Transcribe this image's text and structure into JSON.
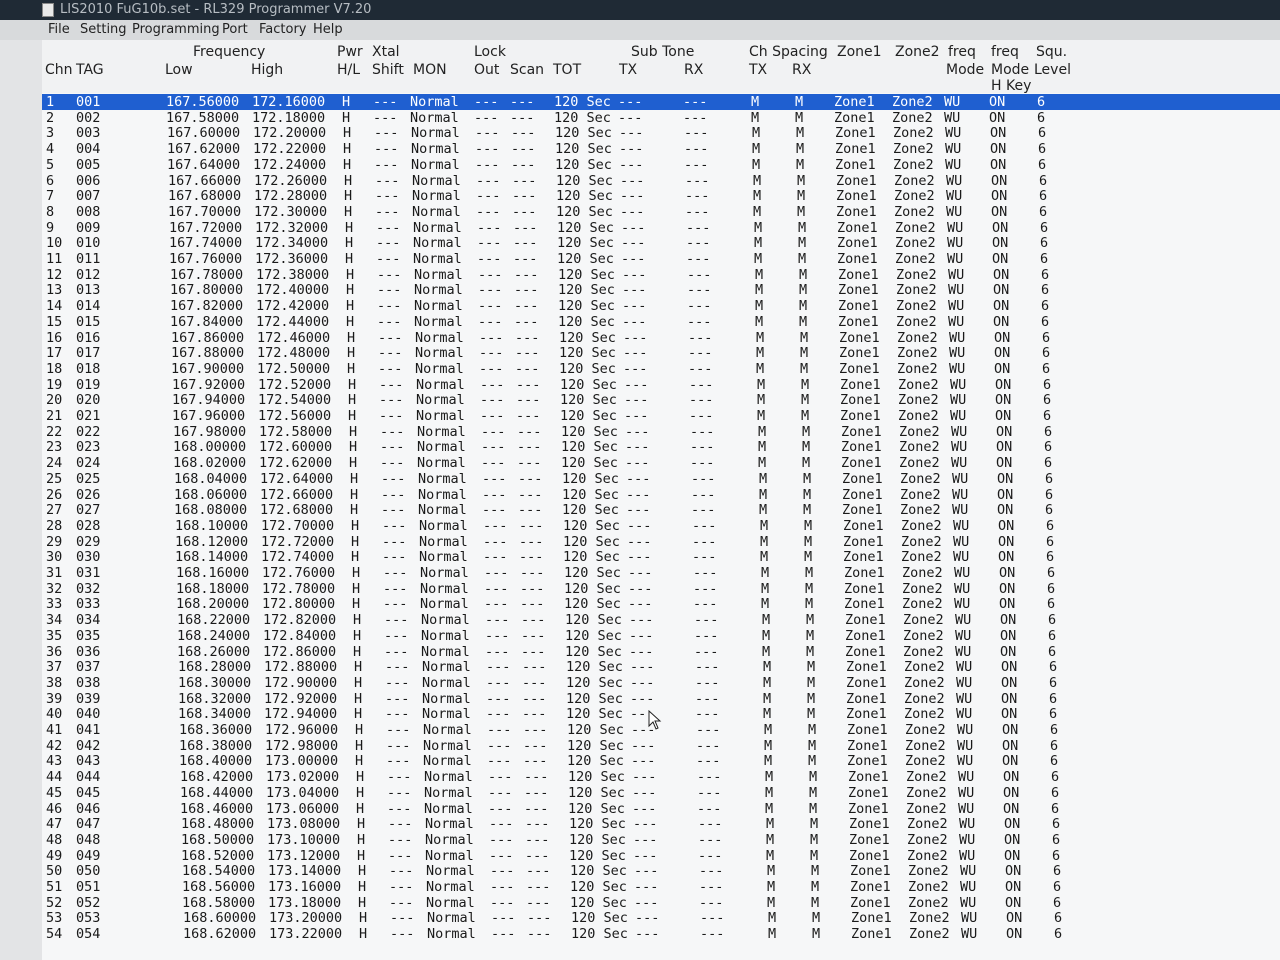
{
  "window": {
    "title": "LIS2010 FuG10b.set - RL329 Programmer V7.20"
  },
  "menu": {
    "items": [
      "File",
      "Setting",
      "Programming",
      "Port",
      "Factory",
      "Help"
    ]
  },
  "columns": {
    "chn": "Chn",
    "tag": "TAG",
    "frequency": "Frequency",
    "low": "Low",
    "high": "High",
    "pwr": "Pwr",
    "hl": "H/L",
    "xtal": "Xtal",
    "shift": "Shift",
    "mon": "MON",
    "lock": "Lock",
    "out": "Out",
    "scan": "Scan",
    "tot": "TOT",
    "subtone": "Sub Tone",
    "subtone_tx": "TX",
    "subtone_rx": "RX",
    "chspacing": "Ch Spacing",
    "chspacing_tx": "TX",
    "chspacing_rx": "RX",
    "zone1": "Zone1",
    "zone2": "Zone2",
    "freqmode": "freq",
    "freqmode2": "Mode",
    "freqhkey": "freq",
    "freqhkey2": "Mode",
    "freqhkey3": "H Key",
    "squ": "Squ.",
    "squ2": "Level"
  },
  "defaults": {
    "pwr": "H",
    "xtal_shift": "---",
    "mon": "Normal",
    "lock_out": "---",
    "scan": "---",
    "tot": "120 Sec",
    "sub_tx": "---",
    "sub_rx": "---",
    "ch_tx": "M",
    "ch_rx": "M",
    "zone1": "Zone1",
    "zone2": "Zone2",
    "freq_mode": "WU",
    "h_key": "ON",
    "squ_level": "6"
  },
  "rows": [
    {
      "chn": "1",
      "tag": "001",
      "low": "167.56000",
      "high": "172.16000"
    },
    {
      "chn": "2",
      "tag": "002",
      "low": "167.58000",
      "high": "172.18000"
    },
    {
      "chn": "3",
      "tag": "003",
      "low": "167.60000",
      "high": "172.20000"
    },
    {
      "chn": "4",
      "tag": "004",
      "low": "167.62000",
      "high": "172.22000"
    },
    {
      "chn": "5",
      "tag": "005",
      "low": "167.64000",
      "high": "172.24000"
    },
    {
      "chn": "6",
      "tag": "006",
      "low": "167.66000",
      "high": "172.26000"
    },
    {
      "chn": "7",
      "tag": "007",
      "low": "167.68000",
      "high": "172.28000"
    },
    {
      "chn": "8",
      "tag": "008",
      "low": "167.70000",
      "high": "172.30000"
    },
    {
      "chn": "9",
      "tag": "009",
      "low": "167.72000",
      "high": "172.32000"
    },
    {
      "chn": "10",
      "tag": "010",
      "low": "167.74000",
      "high": "172.34000"
    },
    {
      "chn": "11",
      "tag": "011",
      "low": "167.76000",
      "high": "172.36000"
    },
    {
      "chn": "12",
      "tag": "012",
      "low": "167.78000",
      "high": "172.38000"
    },
    {
      "chn": "13",
      "tag": "013",
      "low": "167.80000",
      "high": "172.40000"
    },
    {
      "chn": "14",
      "tag": "014",
      "low": "167.82000",
      "high": "172.42000"
    },
    {
      "chn": "15",
      "tag": "015",
      "low": "167.84000",
      "high": "172.44000"
    },
    {
      "chn": "16",
      "tag": "016",
      "low": "167.86000",
      "high": "172.46000"
    },
    {
      "chn": "17",
      "tag": "017",
      "low": "167.88000",
      "high": "172.48000"
    },
    {
      "chn": "18",
      "tag": "018",
      "low": "167.90000",
      "high": "172.50000"
    },
    {
      "chn": "19",
      "tag": "019",
      "low": "167.92000",
      "high": "172.52000"
    },
    {
      "chn": "20",
      "tag": "020",
      "low": "167.94000",
      "high": "172.54000"
    },
    {
      "chn": "21",
      "tag": "021",
      "low": "167.96000",
      "high": "172.56000"
    },
    {
      "chn": "22",
      "tag": "022",
      "low": "167.98000",
      "high": "172.58000"
    },
    {
      "chn": "23",
      "tag": "023",
      "low": "168.00000",
      "high": "172.60000"
    },
    {
      "chn": "24",
      "tag": "024",
      "low": "168.02000",
      "high": "172.62000"
    },
    {
      "chn": "25",
      "tag": "025",
      "low": "168.04000",
      "high": "172.64000"
    },
    {
      "chn": "26",
      "tag": "026",
      "low": "168.06000",
      "high": "172.66000"
    },
    {
      "chn": "27",
      "tag": "027",
      "low": "168.08000",
      "high": "172.68000"
    },
    {
      "chn": "28",
      "tag": "028",
      "low": "168.10000",
      "high": "172.70000"
    },
    {
      "chn": "29",
      "tag": "029",
      "low": "168.12000",
      "high": "172.72000"
    },
    {
      "chn": "30",
      "tag": "030",
      "low": "168.14000",
      "high": "172.74000"
    },
    {
      "chn": "31",
      "tag": "031",
      "low": "168.16000",
      "high": "172.76000"
    },
    {
      "chn": "32",
      "tag": "032",
      "low": "168.18000",
      "high": "172.78000"
    },
    {
      "chn": "33",
      "tag": "033",
      "low": "168.20000",
      "high": "172.80000"
    },
    {
      "chn": "34",
      "tag": "034",
      "low": "168.22000",
      "high": "172.82000"
    },
    {
      "chn": "35",
      "tag": "035",
      "low": "168.24000",
      "high": "172.84000"
    },
    {
      "chn": "36",
      "tag": "036",
      "low": "168.26000",
      "high": "172.86000"
    },
    {
      "chn": "37",
      "tag": "037",
      "low": "168.28000",
      "high": "172.88000"
    },
    {
      "chn": "38",
      "tag": "038",
      "low": "168.30000",
      "high": "172.90000"
    },
    {
      "chn": "39",
      "tag": "039",
      "low": "168.32000",
      "high": "172.92000"
    },
    {
      "chn": "40",
      "tag": "040",
      "low": "168.34000",
      "high": "172.94000"
    },
    {
      "chn": "41",
      "tag": "041",
      "low": "168.36000",
      "high": "172.96000"
    },
    {
      "chn": "42",
      "tag": "042",
      "low": "168.38000",
      "high": "172.98000"
    },
    {
      "chn": "43",
      "tag": "043",
      "low": "168.40000",
      "high": "173.00000"
    },
    {
      "chn": "44",
      "tag": "044",
      "low": "168.42000",
      "high": "173.02000"
    },
    {
      "chn": "45",
      "tag": "045",
      "low": "168.44000",
      "high": "173.04000"
    },
    {
      "chn": "46",
      "tag": "046",
      "low": "168.46000",
      "high": "173.06000"
    },
    {
      "chn": "47",
      "tag": "047",
      "low": "168.48000",
      "high": "173.08000"
    },
    {
      "chn": "48",
      "tag": "048",
      "low": "168.50000",
      "high": "173.10000"
    },
    {
      "chn": "49",
      "tag": "049",
      "low": "168.52000",
      "high": "173.12000"
    },
    {
      "chn": "50",
      "tag": "050",
      "low": "168.54000",
      "high": "173.14000"
    },
    {
      "chn": "51",
      "tag": "051",
      "low": "168.56000",
      "high": "173.16000"
    },
    {
      "chn": "52",
      "tag": "052",
      "low": "168.58000",
      "high": "173.18000"
    },
    {
      "chn": "53",
      "tag": "053",
      "low": "168.60000",
      "high": "173.20000"
    },
    {
      "chn": "54",
      "tag": "054",
      "low": "168.62000",
      "high": "173.22000"
    }
  ],
  "colors": {
    "selection": "#1f5fd0",
    "titlebar": "#1f2a35",
    "menubar": "#d8dadc"
  },
  "icons": {
    "cursor": "mouse-pointer-icon"
  }
}
